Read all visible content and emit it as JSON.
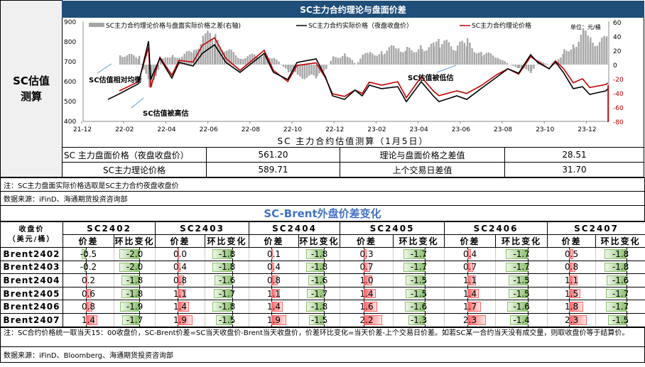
{
  "left_title": [
    "SC估值",
    "测算"
  ],
  "chart_title": "SC主力合约理论与盘面价差",
  "chart_data": {
    "type": "line+bar",
    "title": "SC主力合约理论与盘面价差",
    "unit": "单位：元/桶",
    "legend": [
      "SC主力合约理论价格与盘面实际价格之差(右轴)",
      "SC主力合约实际价格（夜盘收盘价）",
      "SC主力合约理论价格"
    ],
    "legend_placement": "top",
    "x_ticks": [
      "21-12",
      "22-02",
      "22-04",
      "22-06",
      "22-08",
      "22-10",
      "22-12",
      "23-02",
      "23-04",
      "23-06",
      "23-08",
      "23-10",
      "23-12"
    ],
    "x_unit": "months since 2021-12",
    "ylim_left": [
      400,
      900
    ],
    "y_ticks_left": [
      900,
      800,
      700,
      600,
      500,
      400
    ],
    "ylim_right": [
      -80,
      60
    ],
    "y_ticks_right": [
      60,
      40,
      20,
      0,
      -20,
      -40,
      -60,
      -80
    ],
    "x": [
      1.25,
      1.79,
      2.7,
      3.18,
      3.28,
      3.72,
      4.29,
      4.63,
      5.3,
      5.74,
      6.32,
      6.86,
      7.53,
      8.68,
      9.12,
      9.8,
      10.24,
      11.15,
      11.59,
      11.93,
      12.5,
      13.0,
      13.34,
      13.68,
      14.26,
      15.03,
      15.44,
      16.15,
      16.72,
      16.99,
      17.84,
      18.31,
      18.99,
      19.76,
      20.27,
      20.78,
      21.35,
      21.69,
      22.23,
      22.53,
      22.91,
      23.38,
      23.82,
      24.16,
      24.93,
      25.03
    ],
    "actual": [
      507,
      535,
      586,
      800,
      607,
      714,
      614,
      693,
      675,
      739,
      782,
      693,
      643,
      739,
      643,
      607,
      693,
      711,
      621,
      525,
      507,
      554,
      525,
      579,
      561,
      571,
      496,
      596,
      525,
      496,
      525,
      507,
      561,
      621,
      661,
      639,
      732,
      693,
      661,
      696,
      643,
      561,
      571,
      532,
      550,
      561.2
    ],
    "gap": [
      null,
      15,
      10,
      -30,
      -40,
      5,
      15,
      10,
      20,
      40,
      35,
      20,
      10,
      15,
      10,
      -10,
      -15,
      -20,
      -5,
      10,
      15,
      0,
      12,
      15,
      18,
      25,
      20,
      25,
      25,
      30,
      25,
      30,
      15,
      12,
      0,
      -5,
      -10,
      5,
      0,
      5,
      20,
      30,
      40,
      35,
      32,
      28.51
    ],
    "theory": [
      null,
      550,
      596,
      770,
      567,
      719,
      629,
      703,
      695,
      779,
      817,
      713,
      653,
      754,
      653,
      597,
      678,
      691,
      616,
      535,
      522,
      554,
      537,
      594,
      579,
      596,
      516,
      621,
      550,
      526,
      550,
      537,
      576,
      633,
      661,
      634,
      722,
      698,
      661,
      701,
      663,
      591,
      611,
      567,
      582,
      589.71
    ],
    "annotations": [
      "SC估值相对均衡",
      "SC估值被高估",
      "SC估值被低估"
    ]
  },
  "estimate": {
    "title": "SC 主力合约估值测算（1月5日）",
    "row1": {
      "label": "SC 主力盘面价格（夜盘收盘价）",
      "value": "561.20",
      "label2": "理论与盘面价格之差值",
      "value2": "28.51"
    },
    "row2": {
      "label": "SC主力理论价格",
      "value": "589.71",
      "label2": "上个交易日差值",
      "value2": "31.70"
    }
  },
  "note1": "注：SC主力盘面实际价格选取是SC主力合约夜盘收盘价",
  "source1": "数据来源：iFinD、海通期货投资咨询部",
  "brent": {
    "title": "SC-Brent外盘价差变化",
    "corner": [
      "收盘价",
      "（美元/桶）"
    ],
    "sub_price": "价差",
    "sub_change": "环比变化",
    "contracts": [
      "SC2402",
      "SC2403",
      "SC2404",
      "SC2405",
      "SC2406",
      "SC2407"
    ],
    "rows": [
      {
        "label": "Brent2402",
        "price": [
          "-0.5",
          "0.0",
          "0.1",
          "0.3",
          "0.4",
          "0.5"
        ],
        "change": [
          "-2.0",
          "-1.8",
          "-1.8",
          "-1.7",
          "-1.7",
          "-1.8"
        ]
      },
      {
        "label": "Brent2403",
        "price": [
          "-0.2",
          "0.4",
          "0.4",
          "0.7",
          "0.7",
          "0.8"
        ],
        "change": [
          "-2.0",
          "-1.8",
          "-1.8",
          "-1.7",
          "-1.7",
          "-1.8"
        ]
      },
      {
        "label": "Brent2404",
        "price": [
          "0.2",
          "0.8",
          "0.8",
          "1.0",
          "1.1",
          "1.1"
        ],
        "change": [
          "-1.8",
          "-1.6",
          "-1.6",
          "-1.5",
          "-1.5",
          "-1.6"
        ]
      },
      {
        "label": "Brent2405",
        "price": [
          "0.6",
          "1.1",
          "1.1",
          "1.4",
          "1.4",
          "1.5"
        ],
        "change": [
          "-1.8",
          "-1.7",
          "-1.7",
          "-1.5",
          "-1.5",
          "-1.7"
        ]
      },
      {
        "label": "Brent2406",
        "price": [
          "0.8",
          "1.4",
          "1.4",
          "1.6",
          "1.7",
          "1.8"
        ],
        "change": [
          "-1.9",
          "-1.8",
          "-1.8",
          "-1.6",
          "-1.6",
          "-1.7"
        ]
      },
      {
        "label": "Brent2407",
        "price": [
          "1.4",
          "1.9",
          "1.9",
          "2.2",
          "2.3",
          "2.3"
        ],
        "change": [
          "-1.7",
          "-1.5",
          "-1.5",
          "-1.3",
          "-1.4",
          "-1.5"
        ]
      }
    ]
  },
  "note2": "注：SC合约价格统一取当天15：00收盘价，SC-Brent价差=SC当天收盘价-Brent当天收盘价，价差环比变化=当天价差-上个交易日价差。如若SC某一合约当天没有成交量，则取收盘价等于结算价。",
  "source2": "数据来源：iFinD、Bloomberg、海通期货投资咨询部",
  "colors": {
    "header": "#1f4e79",
    "actual": "#000000",
    "theory": "#c00000",
    "gap_bar": "#a6a6a6",
    "brent_title": "#4472c4",
    "pos_bar": "#f8696b",
    "neg_bar": "#8dc26f"
  }
}
